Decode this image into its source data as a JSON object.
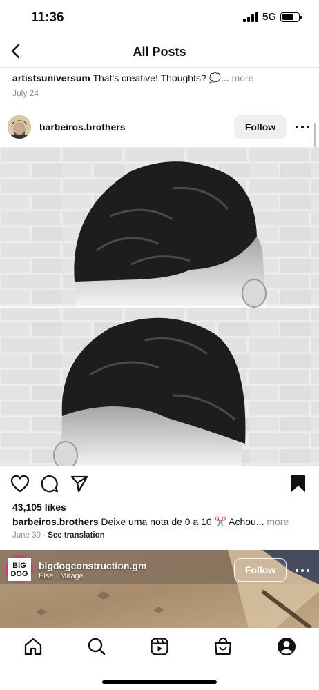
{
  "status_bar": {
    "time": "11:36",
    "network": "5G"
  },
  "nav": {
    "title": "All Posts"
  },
  "previous_post": {
    "username": "artistsuniversum",
    "caption": "That's creative! Thoughts? 💭...",
    "more": "more",
    "date": "July 24"
  },
  "post": {
    "username": "barbeiros.brothers",
    "follow_label": "Follow",
    "likes": "43,105 likes",
    "caption_username": "barbeiros.brothers",
    "caption": "Deixe uma nota de 0 a 10 ✂️ Achou...",
    "more": "more",
    "date": "June 30",
    "separator": "·",
    "translate": "See translation"
  },
  "next_post": {
    "username": "bigdogconstruction.gm",
    "subtitle": "Else · Mirage",
    "follow_label": "Follow",
    "avatar_logo": "BIG DOG"
  },
  "icons": {
    "nav_back": "chevron-left-icon",
    "like": "heart-icon",
    "comment": "comment-icon",
    "share": "send-icon",
    "save": "bookmark-filled-icon",
    "tabs": [
      "home-icon",
      "search-icon",
      "reels-icon",
      "shop-icon",
      "profile-icon"
    ]
  },
  "colors": {
    "follow_bg": "#efefef",
    "text": "#111111",
    "muted": "#8e8e8e",
    "avatar_ring": "#d63384"
  }
}
